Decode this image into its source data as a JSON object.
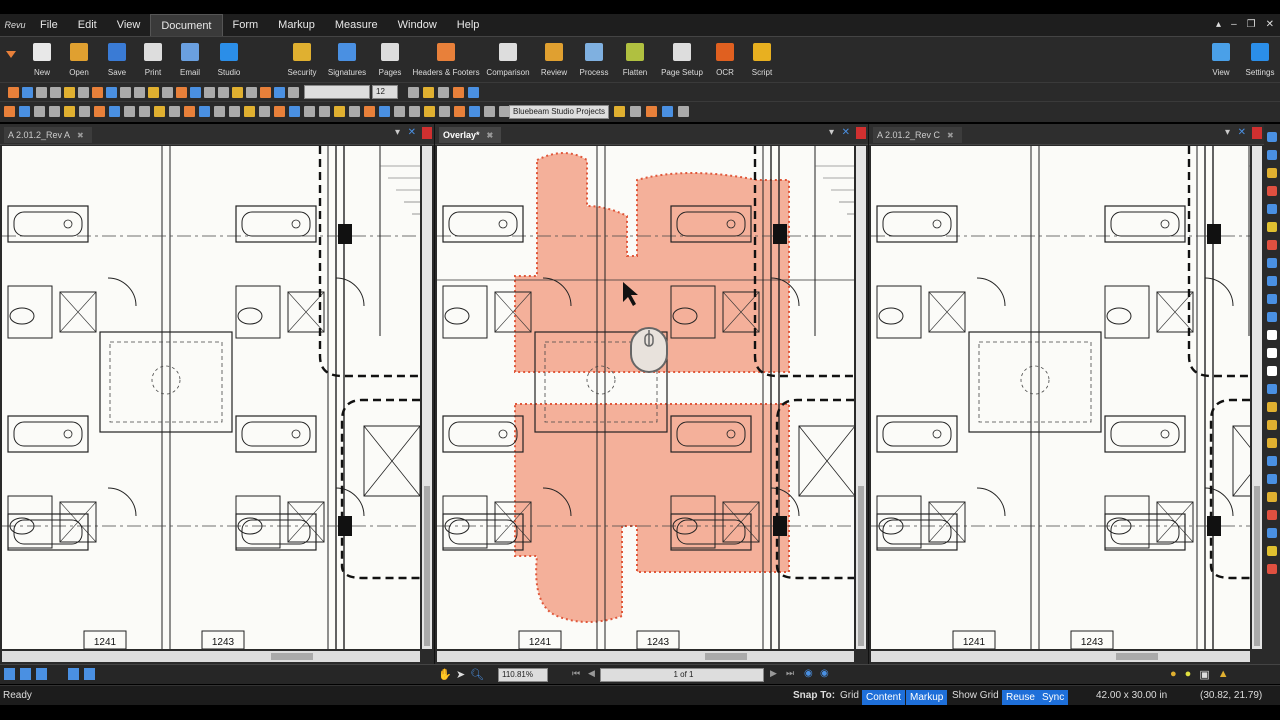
{
  "app": {
    "logo_text": "Revu"
  },
  "menu": [
    "File",
    "Edit",
    "View",
    "Document",
    "Form",
    "Markup",
    "Measure",
    "Window",
    "Help"
  ],
  "menu_active": "Document",
  "window_controls": [
    "▴",
    "–",
    "❐",
    "✕"
  ],
  "ribbon": {
    "left": [
      {
        "label": "New",
        "color": "#e8e8e8"
      },
      {
        "label": "Open",
        "color": "#e0a030"
      },
      {
        "label": "Save",
        "color": "#3a7bd5"
      },
      {
        "label": "Print",
        "color": "#dddddd"
      },
      {
        "label": "Email",
        "color": "#6aa0e0"
      },
      {
        "label": "Studio",
        "color": "#2b8ee8"
      }
    ],
    "right": [
      {
        "label": "Security",
        "color": "#e0b030"
      },
      {
        "label": "Signatures",
        "color": "#4a90e2"
      },
      {
        "label": "Pages",
        "color": "#dddddd"
      },
      {
        "label": "Headers & Footers",
        "color": "#e8803a"
      },
      {
        "label": "Comparison",
        "color": "#dddddd"
      },
      {
        "label": "Review",
        "color": "#e0a030"
      },
      {
        "label": "Process",
        "color": "#7fb0e0"
      },
      {
        "label": "Flatten",
        "color": "#b0c040"
      },
      {
        "label": "Page Setup",
        "color": "#dddddd"
      },
      {
        "label": "OCR",
        "color": "#e06020"
      },
      {
        "label": "Script",
        "color": "#e8b020"
      }
    ],
    "far_right": [
      {
        "label": "View",
        "color": "#4aa0e8"
      },
      {
        "label": "Settings",
        "color": "#2b8ee8"
      }
    ]
  },
  "toolbar": {
    "font_size": "12",
    "profile": "Bluebeam Studio Projects"
  },
  "panes": [
    {
      "tab": "A 2.01.2_Rev A",
      "active": false,
      "overlay": false,
      "rooms": [
        "1241",
        "1243"
      ]
    },
    {
      "tab": "Overlay*",
      "active": true,
      "overlay": true,
      "rooms": [
        "1241",
        "1243"
      ]
    },
    {
      "tab": "A 2.01.2_Rev C",
      "active": false,
      "overlay": false,
      "rooms": [
        "1241",
        "1243"
      ]
    }
  ],
  "pane_controls": {
    "dropdown": "▾",
    "close": "✕",
    "tab_close": "✖"
  },
  "colors": {
    "cloud_fill": "#f2a28a",
    "cloud_stroke": "#e0573a",
    "accent": "#1e6fd9"
  },
  "nav": {
    "zoom": "110.81%",
    "page": "1 of 1"
  },
  "status": {
    "ready": "Ready",
    "snap_to": "Snap To:",
    "grid": "Grid",
    "content": "Content",
    "markup": "Markup",
    "show_grid": "Show Grid",
    "reuse": "Reuse",
    "sync": "Sync",
    "size": "42.00 x 30.00 in",
    "coords": "(30.82, 21.79)"
  }
}
